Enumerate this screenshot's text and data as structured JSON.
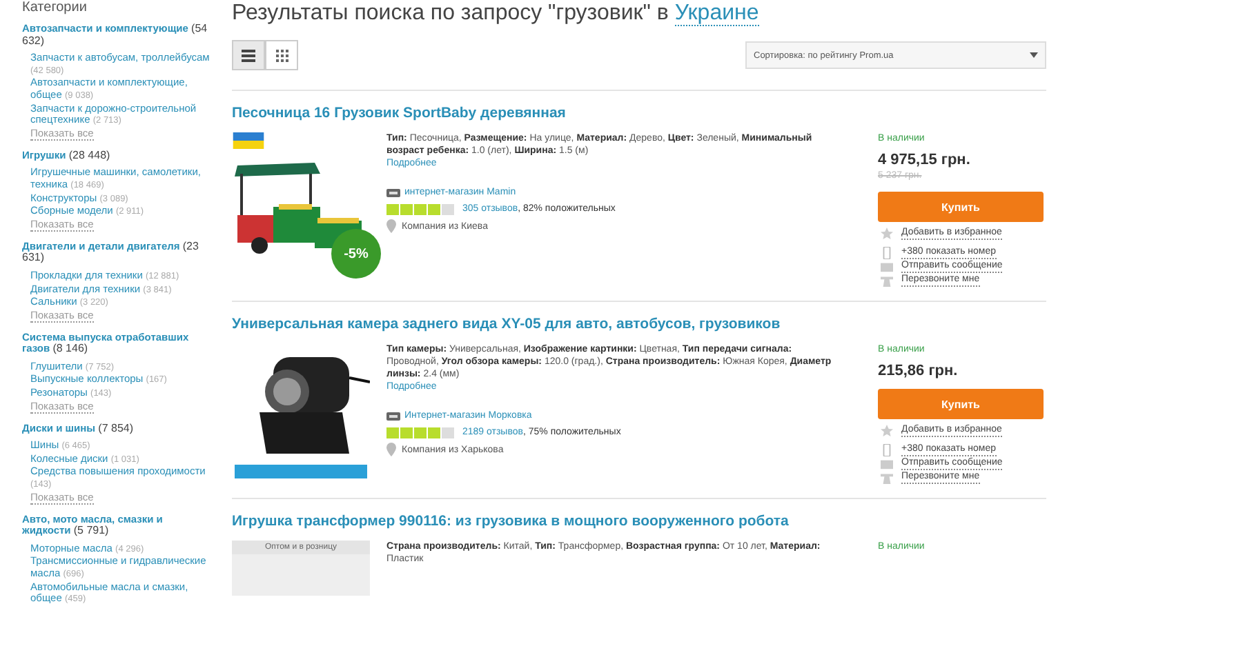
{
  "sidebar": {
    "title": "Категории",
    "groups": [
      {
        "name": "Автозапчасти и комплектующие",
        "count": "(54 632)",
        "items": [
          {
            "name": "Запчасти к автобусам, троллейбусам",
            "count": "(42 580)"
          },
          {
            "name": "Автозапчасти и комплектующие, общее",
            "count": "(9 038)"
          },
          {
            "name": "Запчасти к дорожно-строительной спецтехнике",
            "count": "(2 713)"
          }
        ],
        "show_all": "Показать все"
      },
      {
        "name": "Игрушки",
        "count": "(28 448)",
        "items": [
          {
            "name": "Игрушечные машинки, самолетики, техника",
            "count": "(18 469)"
          },
          {
            "name": "Конструкторы",
            "count": "(3 089)"
          },
          {
            "name": "Сборные модели",
            "count": "(2 911)"
          }
        ],
        "show_all": "Показать все"
      },
      {
        "name": "Двигатели и детали двигателя",
        "count": "(23 631)",
        "items": [
          {
            "name": "Прокладки для техники",
            "count": "(12 881)"
          },
          {
            "name": "Двигатели для техники",
            "count": "(3 841)"
          },
          {
            "name": "Сальники",
            "count": "(3 220)"
          }
        ],
        "show_all": "Показать все"
      },
      {
        "name": "Система выпуска отработавших газов",
        "count": "(8 146)",
        "items": [
          {
            "name": "Глушители",
            "count": "(7 752)"
          },
          {
            "name": "Выпускные коллекторы",
            "count": "(167)"
          },
          {
            "name": "Резонаторы",
            "count": "(143)"
          }
        ],
        "show_all": "Показать все"
      },
      {
        "name": "Диски и шины",
        "count": "(7 854)",
        "items": [
          {
            "name": "Шины",
            "count": "(6 465)"
          },
          {
            "name": "Колесные диски",
            "count": "(1 031)"
          },
          {
            "name": "Средства повышения проходимости",
            "count": "(143)"
          }
        ],
        "show_all": "Показать все"
      },
      {
        "name": "Авто, мото масла, смазки и жидкости",
        "count": "(5 791)",
        "items": [
          {
            "name": "Моторные масла",
            "count": "(4 296)"
          },
          {
            "name": "Трансмиссионные и гидравлические масла",
            "count": "(696)"
          },
          {
            "name": "Автомобильные масла и смазки, общее",
            "count": "(459)"
          }
        ]
      }
    ]
  },
  "heading": {
    "text": "Результаты поиска по запросу \"грузовик\" в",
    "region": "Украине"
  },
  "view_toggles": [
    {
      "kind": "list",
      "selected": true
    },
    {
      "kind": "grid",
      "selected": false
    }
  ],
  "sort": {
    "value": "Сортировка: по рейтингу Prom.ua"
  },
  "products": [
    {
      "title": "Песочница 16 Грузовик SportBaby деревянная",
      "kind": "sandbox",
      "flag": true,
      "discount": "-5%",
      "description": "**Тип:** Песочница, **Размещение:** На улице, **Материал:** Дерево, **Цвет:** Зеленый, **Минимальный возраст ребенка:** 1.0 (лет), **Ширина:** 1.5 (м)",
      "more": "Подробнее",
      "seller": "интернет-магазин Mamin",
      "stars": 4,
      "reviews": "305 отзывов",
      "positive": ", 82% положительных",
      "location": "Компания из Киева",
      "availability": "В наличии",
      "price": "4 975,15 грн.",
      "old_price": "5 237 грн.",
      "buy": "Купить",
      "actions": [
        {
          "kind": "favorite",
          "label": "Добавить в избранное"
        },
        {
          "kind": "phone",
          "label": "+380 показать номер"
        },
        {
          "kind": "message",
          "label": "Отправить сообщение"
        },
        {
          "kind": "callback",
          "label": "Перезвоните мне"
        }
      ]
    },
    {
      "title": "Универсальная камера заднего вида XY-05 для авто, автобусов, грузовиков",
      "kind": "camera",
      "flag": false,
      "description": "**Тип камеры:** Универсальная, **Изображение картинки:** Цветная, **Тип передачи сигнала:** Проводной, **Угол обзора камеры:** 120.0 (град.), **Страна производитель:** Южная Корея, **Диаметр линзы:** 2.4 (мм)",
      "more": "Подробнее",
      "seller": "Интернет-магазин Морковка",
      "stars": 4,
      "reviews": "2189 отзывов",
      "positive": ", 75% положительных",
      "location": "Компания из Харькова",
      "availability": "В наличии",
      "price": "215,86 грн.",
      "buy": "Купить",
      "actions": [
        {
          "kind": "favorite",
          "label": "Добавить в избранное"
        },
        {
          "kind": "phone",
          "label": "+380 показать номер"
        },
        {
          "kind": "message",
          "label": "Отправить сообщение"
        },
        {
          "kind": "callback",
          "label": "Перезвоните мне"
        }
      ]
    },
    {
      "title": "Игрушка трансформер 990116: из грузовика в мощного вооруженного робота",
      "kind": "photo",
      "flag": false,
      "image_label": "Оптом и в розницу",
      "description": "**Страна производитель:** Китай, **Тип:** Трансформер, **Возрастная группа:** От 10 лет, **Материал:** Пластик",
      "availability": "В наличии"
    }
  ]
}
